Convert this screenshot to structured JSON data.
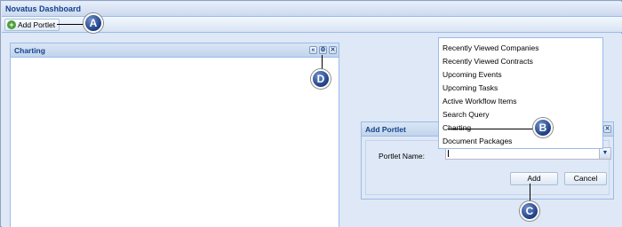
{
  "app": {
    "title": "Novatus Dashboard"
  },
  "toolbar": {
    "add_portlet_label": "Add Portlet"
  },
  "charting_panel": {
    "title": "Charting",
    "tools": [
      "collapse",
      "gear",
      "close"
    ]
  },
  "dropdown": {
    "items": [
      "Recently Viewed Companies",
      "Recently Viewed Contracts",
      "Upcoming Events",
      "Upcoming Tasks",
      "Active Workflow Items",
      "Search Query",
      "Charting",
      "Document Packages"
    ]
  },
  "dialog": {
    "title": "Add Portlet",
    "field_label": "Portlet Name:",
    "field_value": "",
    "add_label": "Add",
    "cancel_label": "Cancel"
  },
  "callouts": {
    "a": "A",
    "b": "B",
    "c": "C",
    "d": "D"
  },
  "colors": {
    "accent": "#15428b",
    "panel_bg": "#dfe8f6",
    "callout": "#1f3f85"
  }
}
